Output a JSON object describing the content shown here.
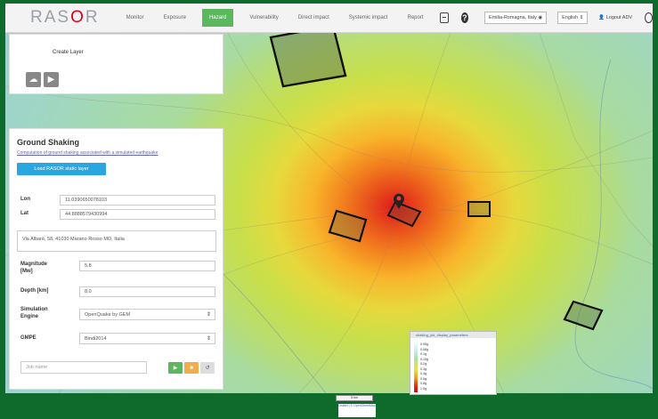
{
  "app": {
    "logo_prefix": "RAS",
    "logo_accent": "O",
    "logo_suffix": "R"
  },
  "nav": {
    "items": [
      {
        "label": "Monitor",
        "active": false
      },
      {
        "label": "Exposure",
        "active": false
      },
      {
        "label": "Hazard",
        "active": true
      },
      {
        "label": "Vulnerability",
        "active": false
      },
      {
        "label": "Direct impact",
        "active": false
      },
      {
        "label": "Systemic impact",
        "active": false
      },
      {
        "label": "Report",
        "active": false
      }
    ]
  },
  "toolbar": {
    "region_select": "Emilia-Romagna, Italy",
    "language": "English",
    "user": "Logout ADV"
  },
  "layer_panel": {
    "title": "Create Layer"
  },
  "ground_shaking": {
    "title": "Ground Shaking",
    "description": "Computation of ground shaking associated with a simulated earthquake",
    "load_button": "Load RASOR static layer",
    "lon_label": "Lon",
    "lon_value": "11.0390650078103",
    "lat_label": "Lat",
    "lat_value": "44.8888579430994",
    "address": "Via Albarè, 58, 41030 Marano Rosso MO, Italia",
    "magnitude_label": "Magnitude [Mw]",
    "magnitude_value": "5.8",
    "depth_label": "Depth [km]",
    "depth_value": "8.0",
    "engine_label": "Simulation Engine",
    "engine_value": "OpenQuake by GEM",
    "gmpe_label": "GMPE",
    "gmpe_value": "Bindi2014",
    "name_placeholder": "Job name",
    "btn_run": "▶",
    "btn_stop": "■",
    "btn_reset": "↺"
  },
  "legend": {
    "title": "shaking_job_display_parameters",
    "items": [
      "0.05g",
      "0.08g",
      "0.1g",
      "0.15g",
      "0.2g",
      "0.3g",
      "0.4g",
      "0.5g",
      "0.6g",
      "1.0g"
    ]
  },
  "scalebar": "5 km",
  "attribution": "Leaflet | © OpenStreetMap",
  "colors": {
    "active_nav": "#5cb85c",
    "load_button": "#2aa7e0",
    "run_button": "#5cb85c",
    "stop_button": "#f0ad4e",
    "reset_button": "#dddddd",
    "frame": "#0f6b2c"
  }
}
